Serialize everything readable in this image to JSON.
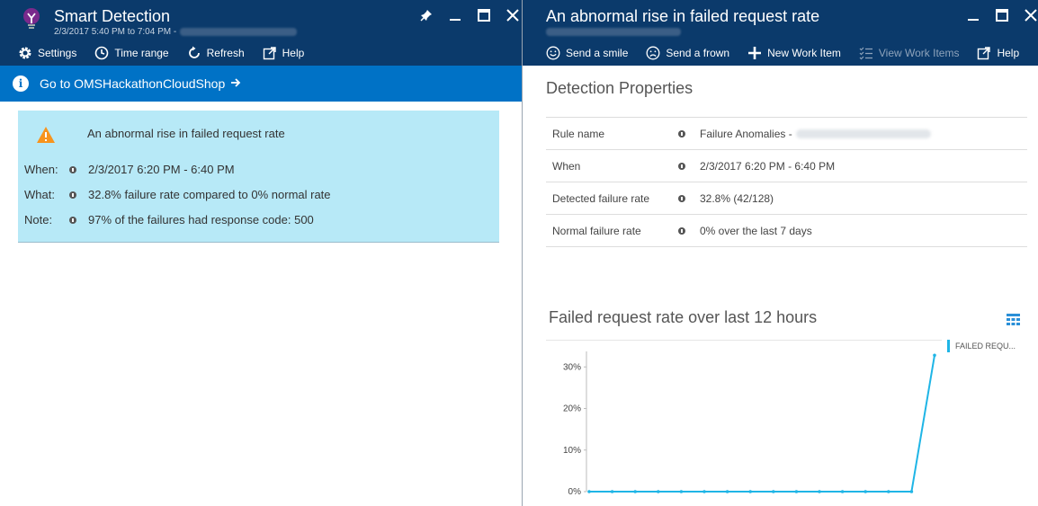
{
  "left_blade": {
    "title": "Smart Detection",
    "subtitle": "2/3/2017 5:40 PM to 7:04 PM -",
    "toolbar": {
      "settings": "Settings",
      "time_range": "Time range",
      "refresh": "Refresh",
      "help": "Help"
    },
    "goto_link": "Go to OMSHackathonCloudShop",
    "alert": {
      "title": "An abnormal rise in failed request rate",
      "rows": [
        {
          "label": "When:",
          "value": "2/3/2017 6:20 PM - 6:40 PM"
        },
        {
          "label": "What:",
          "value": "32.8% failure rate compared to 0% normal rate"
        },
        {
          "label": "Note:",
          "value": "97% of the failures had response code: 500"
        }
      ]
    }
  },
  "right_blade": {
    "title": "An abnormal rise in failed request rate",
    "toolbar": {
      "send_smile": "Send a smile",
      "send_frown": "Send a frown",
      "new_work_item": "New Work Item",
      "view_work_items": "View Work Items",
      "help": "Help"
    },
    "detection_title": "Detection Properties",
    "properties": [
      {
        "name": "Rule name",
        "value": "Failure Anomalies -"
      },
      {
        "name": "When",
        "value": "2/3/2017 6:20 PM - 6:40 PM"
      },
      {
        "name": "Detected failure rate",
        "value": "32.8% (42/128)"
      },
      {
        "name": "Normal failure rate",
        "value": "0% over the last 7 days"
      }
    ],
    "chart_title": "Failed request rate over last 12 hours",
    "legend_label": "FAILED REQU..."
  },
  "colors": {
    "header_bg": "#0b3a6b",
    "goto_bg": "#0072c6",
    "alert_bg": "#b7e9f7",
    "series": "#1fb5e6",
    "warning": "#f7941d"
  },
  "chart_data": {
    "type": "line",
    "title": "Failed request rate over last 12 hours",
    "yticks": [
      "30%",
      "20%",
      "10%",
      "0%"
    ],
    "ylim": [
      0,
      32
    ],
    "series": [
      {
        "name": "FAILED REQU...",
        "values": [
          0,
          0,
          0,
          0,
          0,
          0,
          0,
          0,
          0,
          0,
          0,
          0,
          0,
          0,
          0,
          32.8
        ]
      }
    ],
    "grid": false,
    "legend": "right"
  }
}
